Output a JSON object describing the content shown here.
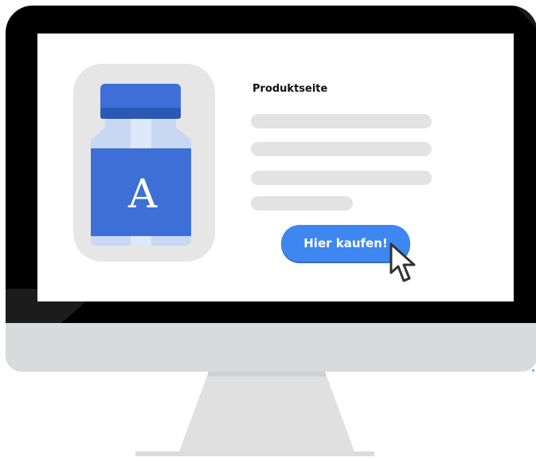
{
  "product": {
    "letter": "A"
  },
  "page": {
    "title": "Produktseite",
    "buy_label": "Hier kaufen!"
  },
  "colors": {
    "bezel": "#000000",
    "screen": "#ffffff",
    "chin": "#d9dadc",
    "stand": "#e0e0e0",
    "accent_blue": "#3f87f0",
    "bottle_blue": "#3a6fd6",
    "placeholder_gray": "#e3e3e3"
  },
  "icons": {
    "pointer": "cursor-arrow-icon",
    "bottle": "medicine-bottle-icon"
  }
}
